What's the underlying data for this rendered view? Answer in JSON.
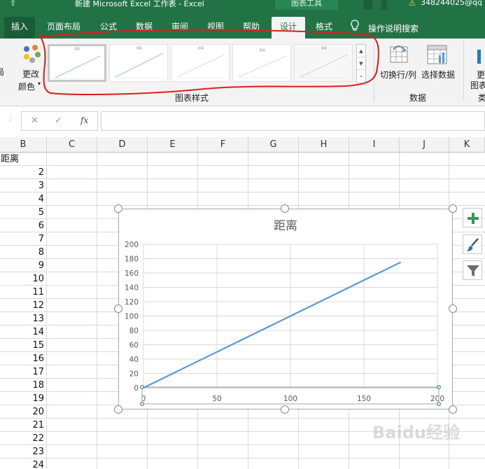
{
  "title_bar": {
    "qat_glyph": "⇧",
    "title": "新建 Microsoft Excel 工作表  -  Excel",
    "context_group": "图表工具",
    "warning_icon": "warning-icon",
    "user": "348244025@qq"
  },
  "tabs": [
    "插入",
    "页面布局",
    "公式",
    "数据",
    "审阅",
    "视图",
    "帮助",
    "设计",
    "格式"
  ],
  "active_tab": "设计",
  "tell_me": "操作说明搜索",
  "ribbon": {
    "left_cut": "局",
    "change_color_line1": "更改",
    "change_color_line2": "颜色",
    "gallery_label": "图表样式",
    "switch_rowcol": "切换行/列",
    "select_data": "选择数据",
    "data_group_label": "数据",
    "right_cut_1": "更",
    "right_cut_2": "图表",
    "right_cut_3": "类",
    "style_thumbs": [
      "距离",
      "距离",
      "距离",
      "距离",
      "距离"
    ]
  },
  "formula_bar": {
    "cancel_glyph": "✕",
    "enter_glyph": "✓",
    "fx": "fx",
    "value": ""
  },
  "columns": [
    "B",
    "C",
    "D",
    "E",
    "F",
    "G",
    "H",
    "I",
    "J",
    "K"
  ],
  "column_b_cells": [
    "距离",
    "2",
    "3",
    "4",
    "5",
    "6",
    "7",
    "8",
    "9",
    "10",
    "11",
    "12",
    "13",
    "14",
    "15",
    "16",
    "17",
    "18",
    "19",
    "20",
    "21",
    "22",
    "23",
    "24"
  ],
  "chart_data": {
    "type": "line",
    "title": "距离",
    "x": [
      0,
      175
    ],
    "series": [
      {
        "values": [
          0,
          175
        ]
      }
    ],
    "xlim": [
      0,
      200
    ],
    "ylim": [
      0,
      200
    ],
    "x_ticks": [
      0,
      50,
      100,
      150,
      200
    ],
    "y_ticks": [
      0,
      20,
      40,
      60,
      80,
      100,
      120,
      140,
      160,
      180,
      200
    ],
    "grid": true,
    "line_color": "#5b9bd5"
  },
  "side_buttons": [
    "plus-icon",
    "brush-icon",
    "filter-icon"
  ],
  "watermark": "Baidu经验",
  "colors": {
    "excel_green": "#217346",
    "annotation_red": "#e11b1b",
    "series_blue": "#5b9bd5"
  }
}
